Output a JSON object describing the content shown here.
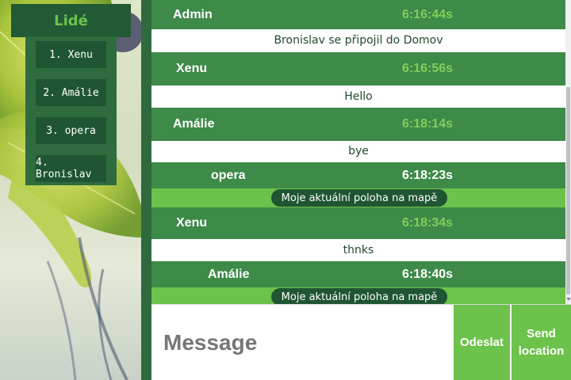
{
  "people": {
    "title": "Lidé",
    "items": [
      "1. Xenu",
      "2. Amálie",
      "3. opera",
      "4. Bronislav"
    ]
  },
  "messages": [
    {
      "name": "Admin",
      "time": "6:16:44s",
      "text": "Bronislav se připojil do Domov"
    },
    {
      "name": "Xenu",
      "time": "6:16:56s",
      "text": "Hello"
    },
    {
      "name": "Amálie",
      "time": "6:18:14s",
      "text": "bye"
    },
    {
      "name": "opera",
      "time": "6:18:23s",
      "link": "Moje aktuální poloha na mapě"
    },
    {
      "name": "Xenu",
      "time": "6:18:34s",
      "text": "thnks"
    },
    {
      "name": "Amálie",
      "time": "6:18:40s",
      "link": "Moje aktuální poloha na mapě"
    }
  ],
  "composer": {
    "placeholder": "Message",
    "send_label": "Odeslat",
    "location_label": "Send location"
  },
  "colors": {
    "dark_green": "#225a35",
    "message_header": "#3d8a49",
    "accent_green": "#6cc24a"
  }
}
